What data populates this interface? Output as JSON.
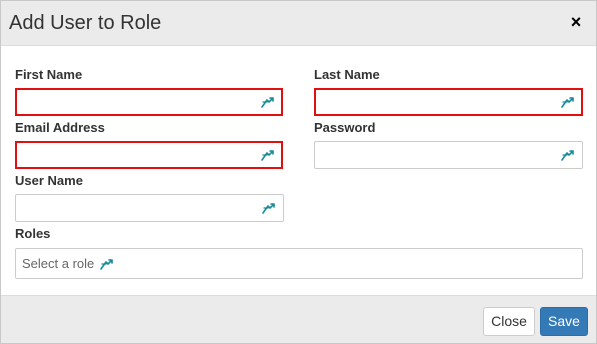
{
  "dialog": {
    "title": "Add User to Role",
    "close_glyph": "×"
  },
  "form": {
    "first_name": {
      "label": "First Name",
      "value": "",
      "invalid": true
    },
    "last_name": {
      "label": "Last Name",
      "value": "",
      "invalid": true
    },
    "email": {
      "label": "Email Address",
      "value": "",
      "invalid": true
    },
    "password": {
      "label": "Password",
      "value": "",
      "invalid": false
    },
    "user_name": {
      "label": "User Name",
      "value": "",
      "invalid": false
    },
    "roles": {
      "label": "Roles",
      "placeholder": "Select a role"
    }
  },
  "footer": {
    "close_label": "Close",
    "save_label": "Save"
  },
  "icons": {
    "field_autofill": "autofill-icon"
  },
  "colors": {
    "header_bg": "#ebebeb",
    "invalid_border": "#e01010",
    "primary": "#337ab7",
    "autofill_icon": "#1a8a9a"
  }
}
